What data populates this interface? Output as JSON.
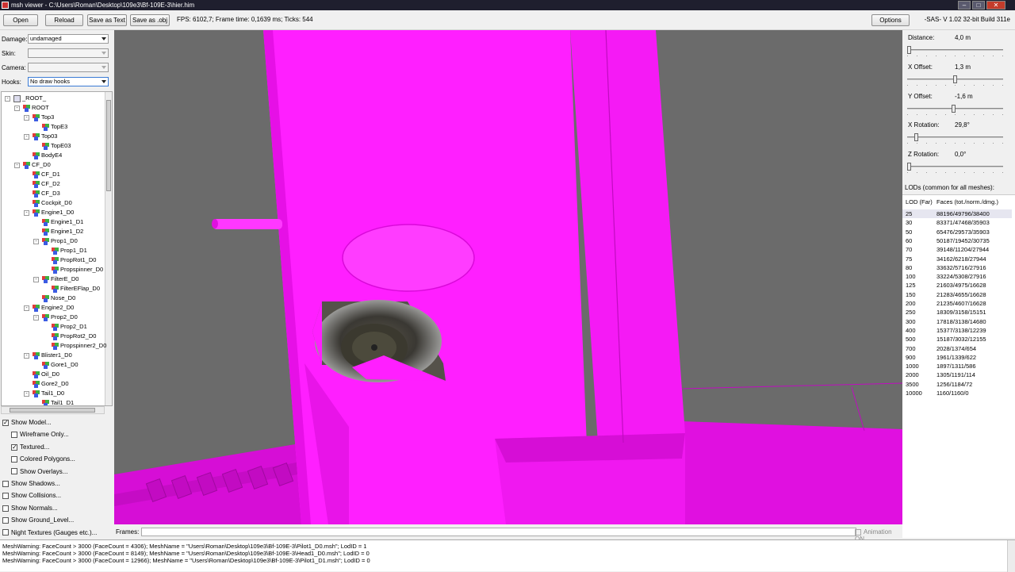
{
  "window": {
    "title": "msh viewer - C:\\Users\\Roman\\Desktop\\109e3\\Bf-109E-3\\hier.him"
  },
  "toolbar": {
    "open": "Open",
    "reload": "Reload",
    "save_text": "Save as Text",
    "save_obj": "Save as .obj",
    "fps": "FPS: 6102,7; Frame time: 0,1639 ms; Ticks: 544",
    "options": "Options",
    "build": "-SAS- V 1.02  32-bit  Build 311e"
  },
  "left": {
    "damage_label": "Damage:",
    "damage_value": "undamaged",
    "skin_label": "Skin:",
    "skin_value": "",
    "camera_label": "Camera:",
    "camera_value": "",
    "hooks_label": "Hooks:",
    "hooks_value": "No draw hooks"
  },
  "tree": [
    {
      "label": "_ROOT_",
      "depth": 0,
      "exp": "-",
      "icon": "root"
    },
    {
      "label": "ROOT",
      "depth": 1,
      "exp": "-"
    },
    {
      "label": "Top3",
      "depth": 2,
      "exp": "-"
    },
    {
      "label": "TopE3",
      "depth": 3,
      "exp": ""
    },
    {
      "label": "Top03",
      "depth": 2,
      "exp": "-"
    },
    {
      "label": "TopE03",
      "depth": 3,
      "exp": ""
    },
    {
      "label": "BodyE4",
      "depth": 2,
      "exp": ""
    },
    {
      "label": "CF_D0",
      "depth": 1,
      "exp": "-"
    },
    {
      "label": "CF_D1",
      "depth": 2,
      "exp": ""
    },
    {
      "label": "CF_D2",
      "depth": 2,
      "exp": ""
    },
    {
      "label": "CF_D3",
      "depth": 2,
      "exp": ""
    },
    {
      "label": "Cockpit_D0",
      "depth": 2,
      "exp": ""
    },
    {
      "label": "Engine1_D0",
      "depth": 2,
      "exp": "-"
    },
    {
      "label": "Engine1_D1",
      "depth": 3,
      "exp": ""
    },
    {
      "label": "Engine1_D2",
      "depth": 3,
      "exp": ""
    },
    {
      "label": "Prop1_D0",
      "depth": 3,
      "exp": "-"
    },
    {
      "label": "Prop1_D1",
      "depth": 4,
      "exp": ""
    },
    {
      "label": "PropRot1_D0",
      "depth": 4,
      "exp": ""
    },
    {
      "label": "Propspinner_D0",
      "depth": 4,
      "exp": ""
    },
    {
      "label": "FilterE_D0",
      "depth": 3,
      "exp": "-"
    },
    {
      "label": "FilterEFlap_D0",
      "depth": 4,
      "exp": ""
    },
    {
      "label": "Nose_D0",
      "depth": 3,
      "exp": ""
    },
    {
      "label": "Engine2_D0",
      "depth": 2,
      "exp": "-"
    },
    {
      "label": "Prop2_D0",
      "depth": 3,
      "exp": "-"
    },
    {
      "label": "Prop2_D1",
      "depth": 4,
      "exp": ""
    },
    {
      "label": "PropRot2_D0",
      "depth": 4,
      "exp": ""
    },
    {
      "label": "Propspinner2_D0",
      "depth": 4,
      "exp": ""
    },
    {
      "label": "Blister1_D0",
      "depth": 2,
      "exp": "-"
    },
    {
      "label": "Gore1_D0",
      "depth": 3,
      "exp": ""
    },
    {
      "label": "Oil_D0",
      "depth": 2,
      "exp": ""
    },
    {
      "label": "Gore2_D0",
      "depth": 2,
      "exp": ""
    },
    {
      "label": "Tail1_D0",
      "depth": 2,
      "exp": "-"
    },
    {
      "label": "Tail1_D1",
      "depth": 3,
      "exp": ""
    }
  ],
  "checks": [
    {
      "label": "Show Model...",
      "checked": true,
      "indent": 0
    },
    {
      "label": "Wireframe Only...",
      "checked": false,
      "indent": 1
    },
    {
      "label": "Textured...",
      "checked": true,
      "indent": 1
    },
    {
      "label": "Colored Polygons...",
      "checked": false,
      "indent": 1
    },
    {
      "label": "Show Overlays...",
      "checked": false,
      "indent": 1
    },
    {
      "label": "Show Shadows...",
      "checked": false,
      "indent": 0
    },
    {
      "label": "Show Collisions...",
      "checked": false,
      "indent": 0
    },
    {
      "label": "Show Normals...",
      "checked": false,
      "indent": 0
    },
    {
      "label": "Show Ground_Level...",
      "checked": false,
      "indent": 0
    },
    {
      "label": "Night Textures (Gauges etc.)...",
      "checked": false,
      "indent": 0
    }
  ],
  "frames": {
    "label": "Frames:",
    "animation": "Animation ON"
  },
  "right": {
    "sliders": [
      {
        "label": "Distance:",
        "value": "4,0 m",
        "pos": 0.0
      },
      {
        "label": "X Offset:",
        "value": "1,3 m",
        "pos": 0.5
      },
      {
        "label": "Y Offset:",
        "value": "-1,6 m",
        "pos": 0.48
      },
      {
        "label": "X Rotation:",
        "value": "29,8°",
        "pos": 0.08
      },
      {
        "label": "Z Rotation:",
        "value": "0,0°",
        "pos": 0.0
      }
    ],
    "lod_header": "LODs (common for all meshes):",
    "col_lod": "LOD (Far)",
    "col_faces": "Faces (tot./norm./dmg.)",
    "lods": [
      [
        "25",
        "88196/49796/38400"
      ],
      [
        "30",
        "83371/47468/35903"
      ],
      [
        "50",
        "65476/29573/35903"
      ],
      [
        "60",
        "50187/19452/30735"
      ],
      [
        "70",
        "39148/11204/27944"
      ],
      [
        "75",
        "34162/6218/27944"
      ],
      [
        "80",
        "33632/5716/27916"
      ],
      [
        "100",
        "33224/5308/27916"
      ],
      [
        "125",
        "21603/4975/16628"
      ],
      [
        "150",
        "21283/4655/16628"
      ],
      [
        "200",
        "21235/4607/16628"
      ],
      [
        "250",
        "18309/3158/15151"
      ],
      [
        "300",
        "17818/3138/14680"
      ],
      [
        "400",
        "15377/3138/12239"
      ],
      [
        "500",
        "15187/3032/12155"
      ],
      [
        "700",
        "2028/1374/654"
      ],
      [
        "900",
        "1961/1339/622"
      ],
      [
        "1000",
        "1897/1311/586"
      ],
      [
        "2000",
        "1305/1191/114"
      ],
      [
        "3500",
        "1256/1184/72"
      ],
      [
        "10000",
        "1160/1160/0"
      ]
    ]
  },
  "log": [
    "MeshWarning: FaceCount > 3000 (FaceCount = 4306); MeshName = \"Users\\Roman\\Desktop\\109e3\\Bf-109E-3\\Pilot1_D0.msh\"; LodID = 1",
    "MeshWarning: FaceCount > 3000 (FaceCount = 8149); MeshName = \"Users\\Roman\\Desktop\\109e3\\Bf-109E-3\\Head1_D0.msh\"; LodID = 0",
    "MeshWarning: FaceCount > 3000 (FaceCount = 12966); MeshName = \"Users\\Roman\\Desktop\\109e3\\Bf-109E-3\\Pilot1_D1.msh\"; LodID = 0"
  ],
  "colors": {
    "mesh": "#ff1fff",
    "viewport_bg": "#6b6b6b",
    "titlebar": "#1f1f2e"
  }
}
